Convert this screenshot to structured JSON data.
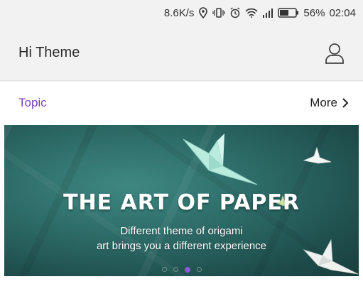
{
  "status_bar": {
    "net_speed": "8.6K/s",
    "battery_percent": "56%",
    "time": "02:04",
    "icons": [
      "location-icon",
      "vibrate-icon",
      "alarm-icon",
      "wifi-icon",
      "signal-icon",
      "battery-icon"
    ]
  },
  "header": {
    "title": "Hi Theme",
    "profile_icon": "person-icon"
  },
  "section": {
    "title": "Topic",
    "more_label": "More"
  },
  "banner": {
    "title": "THE ART OF PAPER",
    "subtitle_line1": "Different theme of origami",
    "subtitle_line2": "art brings you a different experience",
    "page_count": 4,
    "active_page": 3
  },
  "colors": {
    "accent": "#7b3fbf",
    "indicator_active": "#8a5ad6",
    "banner_bg": "#2f6f6b"
  }
}
